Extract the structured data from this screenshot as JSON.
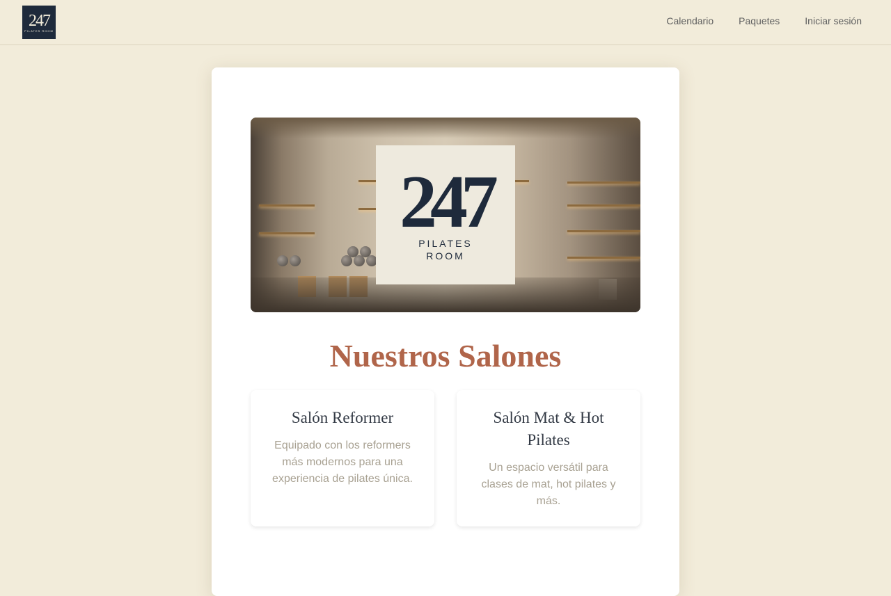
{
  "navbar": {
    "logo": {
      "number": "247",
      "line1": "PILATES ROOM"
    },
    "links": [
      "Calendario",
      "Paquetes",
      "Iniciar sesión"
    ]
  },
  "hero": {
    "logo": {
      "number": "247",
      "line1": "PILATES",
      "line2": "ROOM"
    }
  },
  "section": {
    "title": "Nuestros Salones"
  },
  "salons": [
    {
      "title": "Salón Reformer",
      "description": "Equipado con los reformers más modernos para una experiencia de pilates única."
    },
    {
      "title": "Salón Mat & Hot Pilates",
      "description": "Un espacio versátil para clases de mat, hot pilates y más."
    }
  ],
  "colors": {
    "background": "#f2ecda",
    "navy": "#1e2a3b",
    "accent": "#b0654a",
    "muted": "#a8a192"
  }
}
